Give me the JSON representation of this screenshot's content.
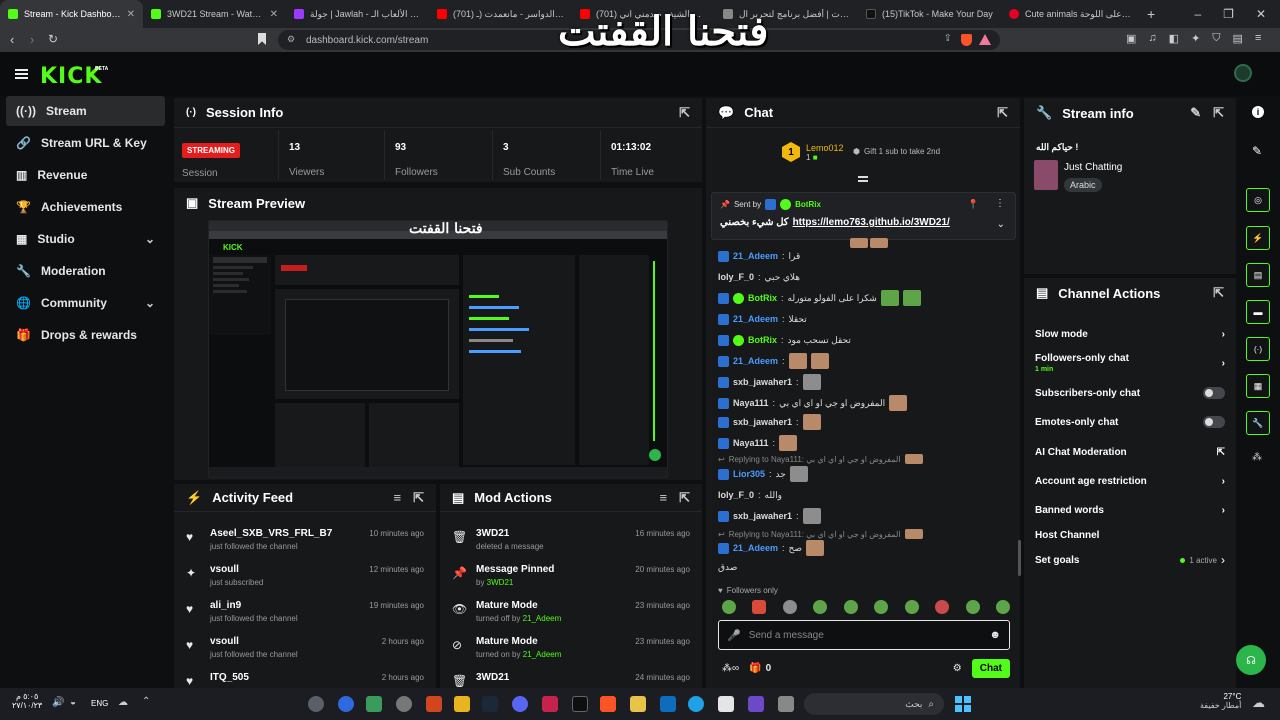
{
  "browser": {
    "tabs": [
      {
        "title": "Stream - Kick Dashboard",
        "color": "#53fc18",
        "active": true
      },
      {
        "title": "3WD21 Stream - Watch Live on",
        "color": "#53fc18"
      },
      {
        "title": "جولة | Jawlah - منصة الألعاب الـ",
        "color": "#9a3cff"
      },
      {
        "title": "(701) شبل الدواسر - مانعمدت (ـ",
        "color": "#ff0000"
      },
      {
        "title": "(701) كليب الشيف صدمني اني...",
        "color": "#ff0000"
      },
      {
        "title": "التنبيهات | أفضل برنامج لتحرير ال",
        "color": "#888888"
      },
      {
        "title": "(15)TikTok - Make Your Day",
        "color": "#111111"
      },
      {
        "title": "Cute animals منشور على اللوحة",
        "color": "#e60023"
      }
    ],
    "url": "dashboard.kick.com/stream"
  },
  "overlay_title": "فتحنا القفتت",
  "logo": "KICK",
  "logo_beta": "BETA",
  "sidebar": {
    "items": [
      {
        "label": "Stream",
        "icon": "broadcast-icon"
      },
      {
        "label": "Stream URL & Key",
        "icon": "link-icon"
      },
      {
        "label": "Revenue",
        "icon": "chart-icon"
      },
      {
        "label": "Achievements",
        "icon": "trophy-icon"
      },
      {
        "label": "Studio",
        "icon": "studio-icon"
      },
      {
        "label": "Moderation",
        "icon": "wrench-icon"
      },
      {
        "label": "Community",
        "icon": "globe-icon"
      },
      {
        "label": "Drops & rewards",
        "icon": "gift-icon"
      }
    ]
  },
  "session": {
    "title": "Session Info",
    "status": "STREAMING",
    "session_label": "Session",
    "stats": [
      {
        "value": "13",
        "label": "Viewers"
      },
      {
        "value": "93",
        "label": "Followers"
      },
      {
        "value": "3",
        "label": "Sub Counts"
      },
      {
        "value": "01:13:02",
        "label": "Time Live"
      }
    ]
  },
  "preview": {
    "title": "Stream Preview",
    "overlay": "فتحنا القفتت"
  },
  "activity": {
    "title": "Activity Feed",
    "items": [
      {
        "user": "Aseel_SXB_VRS_FRL_B7",
        "action": "just followed the channel",
        "time": "10 minutes ago",
        "icon": "heart-icon"
      },
      {
        "user": "vsoull",
        "action": "just subscribed",
        "time": "12 minutes ago",
        "icon": "star-icon"
      },
      {
        "user": "ali_in9",
        "action": "just followed the channel",
        "time": "19 minutes ago",
        "icon": "heart-icon"
      },
      {
        "user": "vsoull",
        "action": "just followed the channel",
        "time": "2 hours ago",
        "icon": "heart-icon"
      },
      {
        "user": "ITQ_505",
        "action": "",
        "time": "2 hours ago",
        "icon": "heart-icon"
      }
    ]
  },
  "mod": {
    "title": "Mod Actions",
    "items": [
      {
        "title": "3WD21",
        "sub_pre": "deleted a message",
        "sub_user": "",
        "time": "16 minutes ago",
        "icon": "trash-icon"
      },
      {
        "title": "Message Pinned",
        "sub_pre": "by ",
        "sub_user": "3WD21",
        "time": "20 minutes ago",
        "icon": "pin-icon"
      },
      {
        "title": "Mature Mode",
        "sub_pre": "turned off by ",
        "sub_user": "21_Adeem",
        "time": "23 minutes ago",
        "icon": "eye-icon"
      },
      {
        "title": "Mature Mode",
        "sub_pre": "turned on by ",
        "sub_user": "21_Adeem",
        "time": "23 minutes ago",
        "icon": "eye-off-icon"
      },
      {
        "title": "3WD21",
        "sub_pre": "",
        "sub_user": "",
        "time": "24 minutes ago",
        "icon": "trash-icon"
      }
    ]
  },
  "chat": {
    "title": "Chat",
    "top_gifter": "Lemo012",
    "top_gifter_count": "1",
    "gift_text": "Gift 1 sub to take 2nd",
    "pinned": {
      "sent_by": "Sent by",
      "user": "BotRix",
      "text": "كل شيء بخصني",
      "link": "https://lemo763.github.io/3WD21/"
    },
    "messages": [
      {
        "user": "21_Adeem",
        "text": "قرا",
        "color": "#4a9cff"
      },
      {
        "user": "loly_F_0",
        "text": "هلاي حبي",
        "color": "#dddddd"
      },
      {
        "user": "BotRix",
        "text": "شكرا على الفولو متورله",
        "color": "#53fc18"
      },
      {
        "user": "21_Adeem",
        "text": "تحقلا",
        "color": "#4a9cff"
      },
      {
        "user": "BotRix",
        "text": "تحقل تسحب مود",
        "color": "#53fc18"
      },
      {
        "user": "21_Adeem",
        "text": "",
        "color": "#4a9cff"
      },
      {
        "user": "sxb_jawaher1",
        "text": "",
        "color": "#dddddd"
      },
      {
        "user": "Naya111",
        "text": "المفروض او جي او اي اي بي",
        "color": "#dddddd"
      },
      {
        "user": "sxb_jawaher1",
        "text": "",
        "color": "#dddddd"
      },
      {
        "user": "Naya111",
        "text": "",
        "color": "#dddddd"
      },
      {
        "user": "Lior305",
        "text": "جد",
        "color": "#4a9cff"
      },
      {
        "user": "loly_F_0",
        "text": "والله",
        "color": "#dddddd"
      },
      {
        "user": "sxb_jawaher1",
        "text": "",
        "color": "#dddddd"
      },
      {
        "user": "21_Adeem",
        "text": "صح",
        "color": "#4a9cff"
      },
      {
        "user": "",
        "text": "صدق",
        "color": "#dddddd"
      }
    ],
    "reply1": "Replying to Naya111: المفروض او جي او اي اي بي",
    "reply2": "Replying to Naya111: المفروض او جي او اي اي بي",
    "followers_only": "Followers only",
    "placeholder": "Send a message",
    "count": "0",
    "chat_button": "Chat"
  },
  "stream_info": {
    "title": "Stream info",
    "stream_title": "حياكم الله !",
    "category": "Just Chatting",
    "tag": "Arabic"
  },
  "channel_actions": {
    "title": "Channel Actions",
    "slow": "Slow mode",
    "followers_only": "Followers-only chat",
    "followers_duration": "1 min",
    "subs_only": "Subscribers-only chat",
    "emotes_only": "Emotes-only chat",
    "ai_mod": "AI Chat Moderation",
    "age": "Account age restriction",
    "banned": "Banned words",
    "host": "Host Channel",
    "goals": "Set goals",
    "goals_status": "1 active"
  },
  "taskbar": {
    "time": "٥:٠٥ م",
    "date": "٢٧/١٠/٢٣",
    "lang": "ENG",
    "weather_temp": "27°C",
    "weather_desc": "أمطار خفيفة",
    "search": "بحث"
  },
  "colors": {
    "accent": "#53fc18",
    "live": "#e41e1e",
    "panel": "#17181a"
  }
}
